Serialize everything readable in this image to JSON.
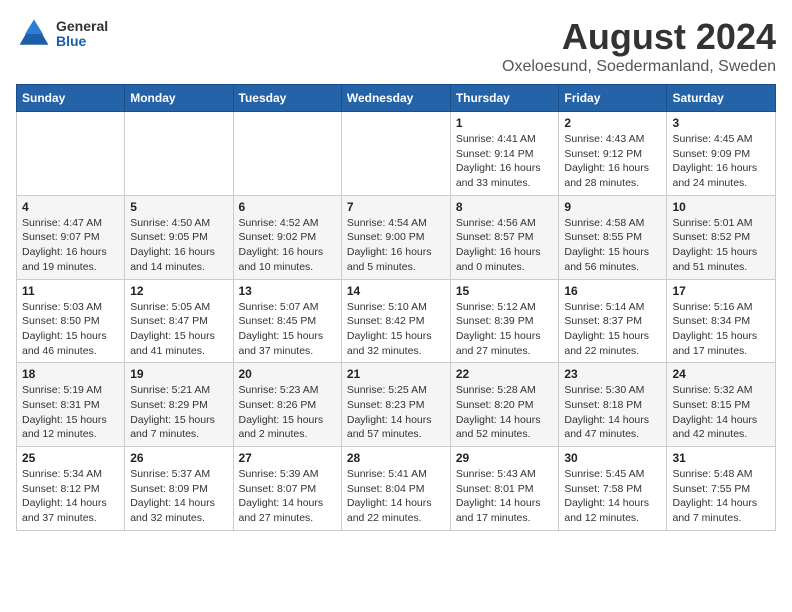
{
  "header": {
    "logo": {
      "general": "General",
      "blue": "Blue"
    },
    "month_year": "August 2024",
    "location": "Oxeloesund, Soedermanland, Sweden"
  },
  "days_of_week": [
    "Sunday",
    "Monday",
    "Tuesday",
    "Wednesday",
    "Thursday",
    "Friday",
    "Saturday"
  ],
  "weeks": [
    [
      {
        "day": "",
        "info": ""
      },
      {
        "day": "",
        "info": ""
      },
      {
        "day": "",
        "info": ""
      },
      {
        "day": "",
        "info": ""
      },
      {
        "day": "1",
        "info": "Sunrise: 4:41 AM\nSunset: 9:14 PM\nDaylight: 16 hours\nand 33 minutes."
      },
      {
        "day": "2",
        "info": "Sunrise: 4:43 AM\nSunset: 9:12 PM\nDaylight: 16 hours\nand 28 minutes."
      },
      {
        "day": "3",
        "info": "Sunrise: 4:45 AM\nSunset: 9:09 PM\nDaylight: 16 hours\nand 24 minutes."
      }
    ],
    [
      {
        "day": "4",
        "info": "Sunrise: 4:47 AM\nSunset: 9:07 PM\nDaylight: 16 hours\nand 19 minutes."
      },
      {
        "day": "5",
        "info": "Sunrise: 4:50 AM\nSunset: 9:05 PM\nDaylight: 16 hours\nand 14 minutes."
      },
      {
        "day": "6",
        "info": "Sunrise: 4:52 AM\nSunset: 9:02 PM\nDaylight: 16 hours\nand 10 minutes."
      },
      {
        "day": "7",
        "info": "Sunrise: 4:54 AM\nSunset: 9:00 PM\nDaylight: 16 hours\nand 5 minutes."
      },
      {
        "day": "8",
        "info": "Sunrise: 4:56 AM\nSunset: 8:57 PM\nDaylight: 16 hours\nand 0 minutes."
      },
      {
        "day": "9",
        "info": "Sunrise: 4:58 AM\nSunset: 8:55 PM\nDaylight: 15 hours\nand 56 minutes."
      },
      {
        "day": "10",
        "info": "Sunrise: 5:01 AM\nSunset: 8:52 PM\nDaylight: 15 hours\nand 51 minutes."
      }
    ],
    [
      {
        "day": "11",
        "info": "Sunrise: 5:03 AM\nSunset: 8:50 PM\nDaylight: 15 hours\nand 46 minutes."
      },
      {
        "day": "12",
        "info": "Sunrise: 5:05 AM\nSunset: 8:47 PM\nDaylight: 15 hours\nand 41 minutes."
      },
      {
        "day": "13",
        "info": "Sunrise: 5:07 AM\nSunset: 8:45 PM\nDaylight: 15 hours\nand 37 minutes."
      },
      {
        "day": "14",
        "info": "Sunrise: 5:10 AM\nSunset: 8:42 PM\nDaylight: 15 hours\nand 32 minutes."
      },
      {
        "day": "15",
        "info": "Sunrise: 5:12 AM\nSunset: 8:39 PM\nDaylight: 15 hours\nand 27 minutes."
      },
      {
        "day": "16",
        "info": "Sunrise: 5:14 AM\nSunset: 8:37 PM\nDaylight: 15 hours\nand 22 minutes."
      },
      {
        "day": "17",
        "info": "Sunrise: 5:16 AM\nSunset: 8:34 PM\nDaylight: 15 hours\nand 17 minutes."
      }
    ],
    [
      {
        "day": "18",
        "info": "Sunrise: 5:19 AM\nSunset: 8:31 PM\nDaylight: 15 hours\nand 12 minutes."
      },
      {
        "day": "19",
        "info": "Sunrise: 5:21 AM\nSunset: 8:29 PM\nDaylight: 15 hours\nand 7 minutes."
      },
      {
        "day": "20",
        "info": "Sunrise: 5:23 AM\nSunset: 8:26 PM\nDaylight: 15 hours\nand 2 minutes."
      },
      {
        "day": "21",
        "info": "Sunrise: 5:25 AM\nSunset: 8:23 PM\nDaylight: 14 hours\nand 57 minutes."
      },
      {
        "day": "22",
        "info": "Sunrise: 5:28 AM\nSunset: 8:20 PM\nDaylight: 14 hours\nand 52 minutes."
      },
      {
        "day": "23",
        "info": "Sunrise: 5:30 AM\nSunset: 8:18 PM\nDaylight: 14 hours\nand 47 minutes."
      },
      {
        "day": "24",
        "info": "Sunrise: 5:32 AM\nSunset: 8:15 PM\nDaylight: 14 hours\nand 42 minutes."
      }
    ],
    [
      {
        "day": "25",
        "info": "Sunrise: 5:34 AM\nSunset: 8:12 PM\nDaylight: 14 hours\nand 37 minutes."
      },
      {
        "day": "26",
        "info": "Sunrise: 5:37 AM\nSunset: 8:09 PM\nDaylight: 14 hours\nand 32 minutes."
      },
      {
        "day": "27",
        "info": "Sunrise: 5:39 AM\nSunset: 8:07 PM\nDaylight: 14 hours\nand 27 minutes."
      },
      {
        "day": "28",
        "info": "Sunrise: 5:41 AM\nSunset: 8:04 PM\nDaylight: 14 hours\nand 22 minutes."
      },
      {
        "day": "29",
        "info": "Sunrise: 5:43 AM\nSunset: 8:01 PM\nDaylight: 14 hours\nand 17 minutes."
      },
      {
        "day": "30",
        "info": "Sunrise: 5:45 AM\nSunset: 7:58 PM\nDaylight: 14 hours\nand 12 minutes."
      },
      {
        "day": "31",
        "info": "Sunrise: 5:48 AM\nSunset: 7:55 PM\nDaylight: 14 hours\nand 7 minutes."
      }
    ]
  ]
}
